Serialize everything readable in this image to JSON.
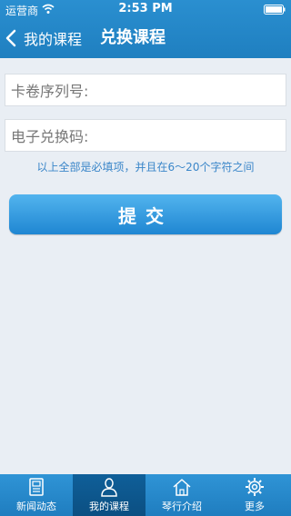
{
  "status_bar": {
    "carrier": "运营商",
    "time": "2:53 PM"
  },
  "nav": {
    "back_label": "我的课程",
    "title": "兑换课程"
  },
  "form": {
    "card_serial_label": "卡卷序列号:",
    "card_serial_value": "",
    "redeem_code_label": "电子兑换码:",
    "redeem_code_value": "",
    "hint": "以上全部是必填项，并且在6～20个字符之间",
    "submit_label": "提交"
  },
  "tabbar": {
    "items": [
      {
        "label": "新闻动态",
        "icon": "news-icon"
      },
      {
        "label": "我的课程",
        "icon": "person-icon",
        "active": true
      },
      {
        "label": "琴行介绍",
        "icon": "home-icon"
      },
      {
        "label": "更多",
        "icon": "gear-icon"
      }
    ]
  },
  "colors": {
    "accent": "#1f7fc0",
    "background": "#e9eef4",
    "hint": "#3a86c9"
  }
}
